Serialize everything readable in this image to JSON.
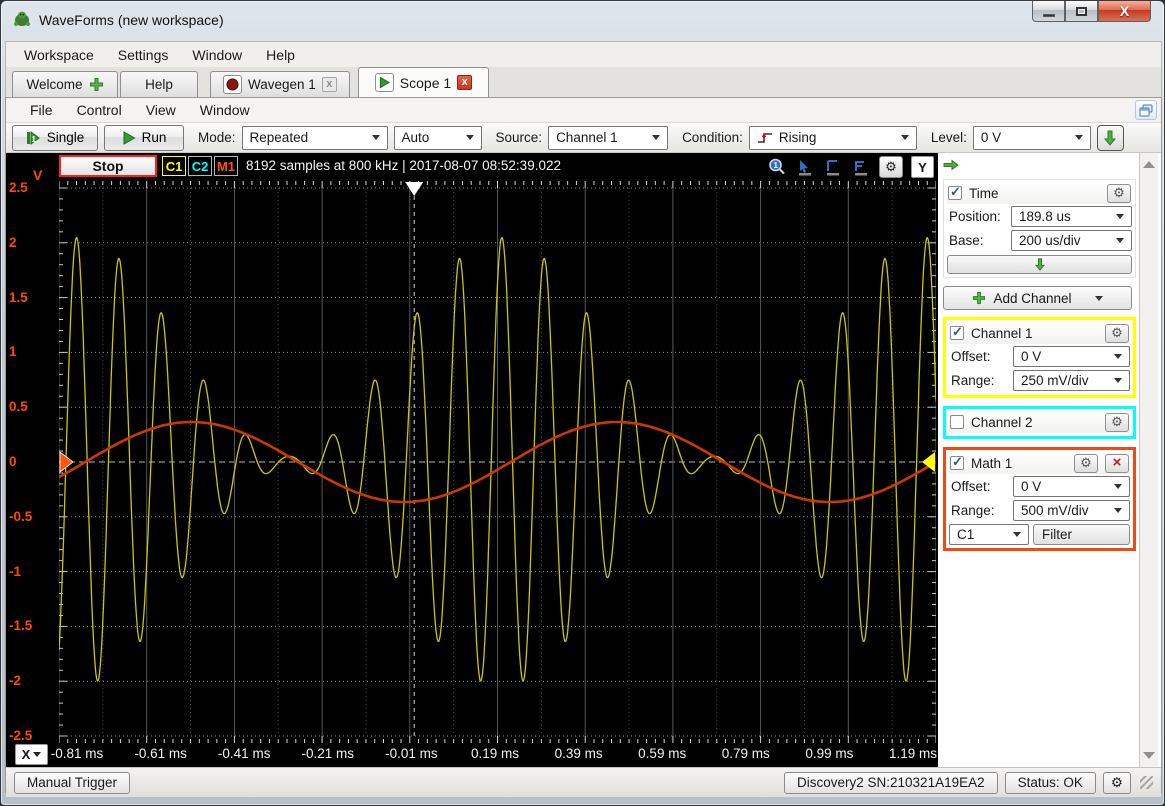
{
  "window": {
    "title": "WaveForms  (new workspace)"
  },
  "menubar": {
    "items": [
      "Workspace",
      "Settings",
      "Window",
      "Help"
    ]
  },
  "tabs": {
    "welcome": "Welcome",
    "help": "Help",
    "wavegen": "Wavegen 1",
    "scope": "Scope 1"
  },
  "scope": {
    "menu": [
      "File",
      "Control",
      "View",
      "Window"
    ],
    "toolbar": {
      "single_label": "Single",
      "run_label": "Run",
      "mode_label": "Mode:",
      "mode_value": "Repeated",
      "trigger_mode_value": "Auto",
      "source_label": "Source:",
      "source_value": "Channel 1",
      "condition_label": "Condition:",
      "condition_value": "Rising",
      "level_label": "Level:",
      "level_value": "0 V"
    },
    "status": {
      "stop_label": "Stop",
      "badges": [
        {
          "label": "C1",
          "color": "#ffff00",
          "border": "#ffff00"
        },
        {
          "label": "C2",
          "color": "#00ffff",
          "border": "#b5b5b5"
        },
        {
          "label": "M1",
          "color": "#ff5500",
          "border": "#b5b5b5"
        }
      ],
      "info": "8192 samples at 800 kHz | 2017-08-07 08:52:39.022",
      "y_axis_button": "Y"
    },
    "plot": {
      "y_unit": "V",
      "y_ticks": [
        "2.5",
        "2",
        "1.5",
        "1",
        "0.5",
        "0",
        "-0.5",
        "-1",
        "-1.5",
        "-2",
        "-2.5"
      ],
      "x_ticks": [
        "-0.81 ms",
        "-0.61 ms",
        "-0.41 ms",
        "-0.21 ms",
        "-0.01 ms",
        "0.19 ms",
        "0.39 ms",
        "0.59 ms",
        "0.79 ms",
        "0.99 ms",
        "1.19 ms"
      ],
      "x_axis_button": "X",
      "grid_color": "#585858",
      "background": "#000000"
    },
    "waveform": {
      "t_start_ms": -0.81,
      "t_end_ms": 1.19,
      "volts_per_div": 0.5,
      "time_per_div_ms": 0.2,
      "trigger_time_ms": 0.0,
      "trigger_level_v": 0.0,
      "c1": {
        "name": "Channel 1 (AM signal)",
        "color": "#c9c900",
        "amplitude_v": 1.05,
        "mod_depth": 0.95,
        "carrier_period_ms": 0.097,
        "carrier_peak_ms": -0.77,
        "mod_period_ms": 0.97,
        "env_max_ms": -0.77
      },
      "m1": {
        "name": "Math 1 (filtered C1)",
        "color": "#cc3900",
        "amplitude_v": 0.365,
        "period_ms": 0.97,
        "rising_zero_ms": -0.75
      }
    },
    "panel": {
      "time": {
        "label": "Time",
        "checked": true,
        "position_label": "Position:",
        "position_value": "189.8 us",
        "base_label": "Base:",
        "base_value": "200 us/div"
      },
      "add_channel_label": "Add Channel",
      "channel1": {
        "label": "Channel 1",
        "checked": true,
        "border": "#ffff00",
        "offset_label": "Offset:",
        "offset_value": "0 V",
        "range_label": "Range:",
        "range_value": "250 mV/div"
      },
      "channel2": {
        "label": "Channel 2",
        "checked": false,
        "border": "#00ffff"
      },
      "math1": {
        "label": "Math 1",
        "checked": true,
        "border": "#f04a12",
        "offset_label": "Offset:",
        "offset_value": "0 V",
        "range_label": "Range:",
        "range_value": "500 mV/div",
        "source_value": "C1",
        "filter_label": "Filter"
      }
    }
  },
  "statusbar": {
    "manual_trigger_label": "Manual Trigger",
    "device_label": "Discovery2 SN:210321A19EA2",
    "status_label": "Status: OK"
  }
}
